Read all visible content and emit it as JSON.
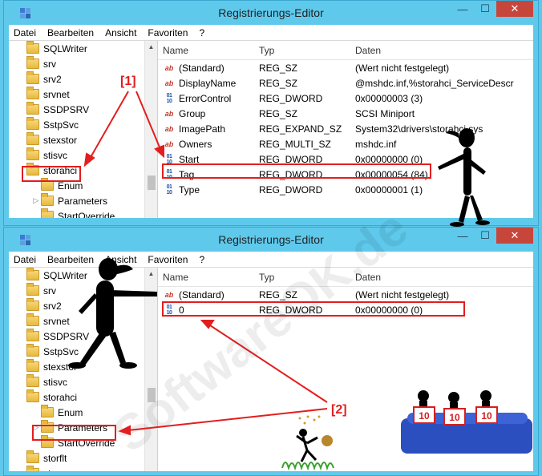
{
  "window1": {
    "title": "Registrierungs-Editor",
    "menu": [
      "Datei",
      "Bearbeiten",
      "Ansicht",
      "Favoriten",
      "?"
    ],
    "tree": [
      {
        "label": "SQLWriter",
        "indent": 0
      },
      {
        "label": "srv",
        "indent": 0
      },
      {
        "label": "srv2",
        "indent": 0
      },
      {
        "label": "srvnet",
        "indent": 0
      },
      {
        "label": "SSDPSRV",
        "indent": 0
      },
      {
        "label": "SstpSvc",
        "indent": 0
      },
      {
        "label": "stexstor",
        "indent": 0
      },
      {
        "label": "stisvc",
        "indent": 0
      },
      {
        "label": "storahci",
        "indent": 0
      },
      {
        "label": "Enum",
        "indent": 1
      },
      {
        "label": "Parameters",
        "indent": 1,
        "expander": "▷"
      },
      {
        "label": "StartOverride",
        "indent": 1
      }
    ],
    "headers": {
      "name": "Name",
      "type": "Typ",
      "data": "Daten"
    },
    "rows": [
      {
        "icon": "ab",
        "name": "(Standard)",
        "type": "REG_SZ",
        "data": "(Wert nicht festgelegt)"
      },
      {
        "icon": "ab",
        "name": "DisplayName",
        "type": "REG_SZ",
        "data": "@mshdc.inf,%storahci_ServiceDescr"
      },
      {
        "icon": "bin",
        "name": "ErrorControl",
        "type": "REG_DWORD",
        "data": "0x00000003 (3)"
      },
      {
        "icon": "ab",
        "name": "Group",
        "type": "REG_SZ",
        "data": "SCSI Miniport"
      },
      {
        "icon": "ab",
        "name": "ImagePath",
        "type": "REG_EXPAND_SZ",
        "data": "System32\\drivers\\storahci.sys"
      },
      {
        "icon": "ab",
        "name": "Owners",
        "type": "REG_MULTI_SZ",
        "data": "mshdc.inf"
      },
      {
        "icon": "bin",
        "name": "Start",
        "type": "REG_DWORD",
        "data": "0x00000000 (0)"
      },
      {
        "icon": "bin",
        "name": "Tag",
        "type": "REG_DWORD",
        "data": "0x00000054 (84)"
      },
      {
        "icon": "bin",
        "name": "Type",
        "type": "REG_DWORD",
        "data": "0x00000001 (1)"
      }
    ]
  },
  "window2": {
    "title": "Registrierungs-Editor",
    "menu": [
      "Datei",
      "Bearbeiten",
      "Ansicht",
      "Favoriten",
      "?"
    ],
    "tree": [
      {
        "label": "SQLWriter",
        "indent": 0
      },
      {
        "label": "srv",
        "indent": 0
      },
      {
        "label": "srv2",
        "indent": 0
      },
      {
        "label": "srvnet",
        "indent": 0
      },
      {
        "label": "SSDPSRV",
        "indent": 0
      },
      {
        "label": "SstpSvc",
        "indent": 0
      },
      {
        "label": "stexstor",
        "indent": 0
      },
      {
        "label": "stisvc",
        "indent": 0
      },
      {
        "label": "storahci",
        "indent": 0
      },
      {
        "label": "Enum",
        "indent": 1
      },
      {
        "label": "Parameters",
        "indent": 1,
        "expander": "▷"
      },
      {
        "label": "StartOverride",
        "indent": 1
      },
      {
        "label": "storflt",
        "indent": 0
      },
      {
        "label": "stornvme",
        "indent": 0
      }
    ],
    "headers": {
      "name": "Name",
      "type": "Typ",
      "data": "Daten"
    },
    "rows": [
      {
        "icon": "ab",
        "name": "(Standard)",
        "type": "REG_SZ",
        "data": "(Wert nicht festgelegt)"
      },
      {
        "icon": "bin",
        "name": "0",
        "type": "REG_DWORD",
        "data": "0x00000000 (0)"
      }
    ]
  },
  "annotations": {
    "label1": "[1]",
    "label2": "[2]"
  },
  "scores": [
    "10",
    "10",
    "10"
  ],
  "watermark": "SoftwareOK.de",
  "colors": {
    "titlebar": "#5fc9ec",
    "close": "#c7463c",
    "highlight": "#e21e1e"
  }
}
